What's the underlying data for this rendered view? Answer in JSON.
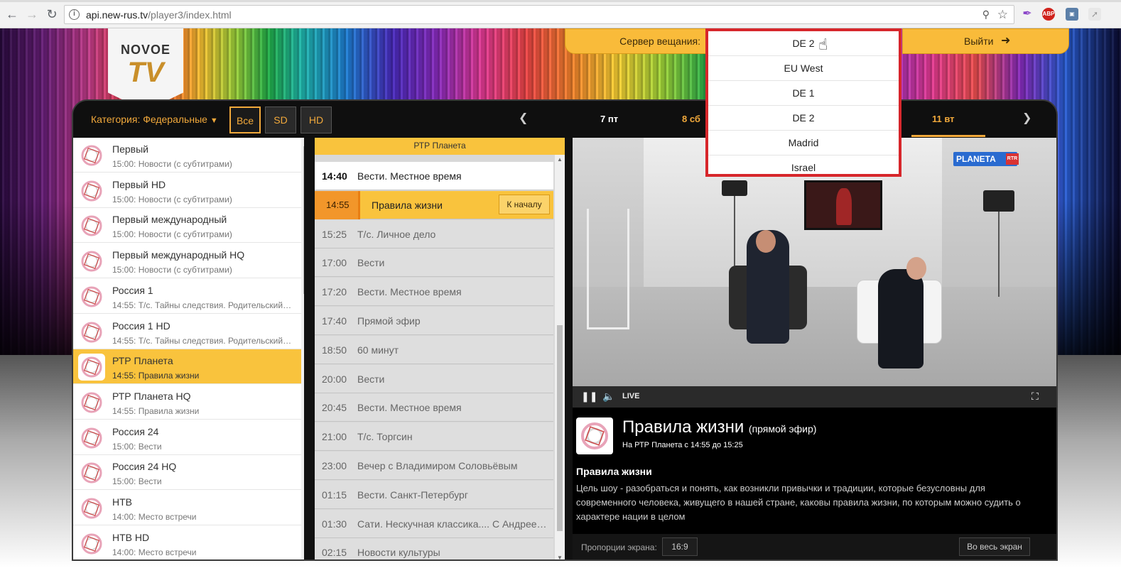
{
  "browser": {
    "url_host": "api.new-rus.tv",
    "url_path": "/player3/index.html"
  },
  "logo": {
    "top": "NOVOE",
    "bottom": "TV"
  },
  "header": {
    "server_label": "Сервер вещания:",
    "exit_label": "Выйти"
  },
  "server_dropdown": {
    "items": [
      "DE 2",
      "EU West",
      "DE 1",
      "DE 2",
      "Madrid",
      "Israel"
    ]
  },
  "topbar": {
    "category": "Категория: Федеральные",
    "filters": [
      "Все",
      "SD",
      "HD"
    ],
    "days": [
      "7 пт",
      "8 сб",
      "11 вт"
    ]
  },
  "channels": [
    {
      "name": "Первый",
      "show": "15:00: Новости (с субтитрами)"
    },
    {
      "name": "Первый HD",
      "show": "15:00: Новости (с субтитрами)"
    },
    {
      "name": "Первый международный",
      "show": "15:00: Новости (с субтитрами)"
    },
    {
      "name": "Первый международный HQ",
      "show": "15:00: Новости (с субтитрами)"
    },
    {
      "name": "Россия 1",
      "show": "14:55: Т/с. Тайны следствия. Родительский д..."
    },
    {
      "name": "Россия 1 HD",
      "show": "14:55: Т/с. Тайны следствия. Родительский д..."
    },
    {
      "name": "РТР Планета",
      "show": "14:55: Правила жизни"
    },
    {
      "name": "РТР Планета HQ",
      "show": "14:55: Правила жизни"
    },
    {
      "name": "Россия 24",
      "show": "15:00: Вести"
    },
    {
      "name": "Россия 24 HQ",
      "show": "15:00: Вести"
    },
    {
      "name": "НТВ",
      "show": "14:00: Место встречи"
    },
    {
      "name": "НТВ HD",
      "show": "14:00: Место встречи"
    }
  ],
  "schedule": {
    "channel": "РТР Планета",
    "to_start": "К началу",
    "rows": [
      {
        "time": "14:40",
        "title": "Вести. Местное время"
      },
      {
        "time": "14:55",
        "title": "Правила жизни"
      },
      {
        "time": "15:25",
        "title": "Т/с. Личное дело"
      },
      {
        "time": "17:00",
        "title": "Вести"
      },
      {
        "time": "17:20",
        "title": "Вести. Местное время"
      },
      {
        "time": "17:40",
        "title": "Прямой эфир"
      },
      {
        "time": "18:50",
        "title": "60 минут"
      },
      {
        "time": "20:00",
        "title": "Вести"
      },
      {
        "time": "20:45",
        "title": "Вести. Местное время"
      },
      {
        "time": "21:00",
        "title": "Т/с. Торгсин"
      },
      {
        "time": "23:00",
        "title": "Вечер с Владимиром Соловьёвым"
      },
      {
        "time": "01:15",
        "title": "Вести. Санкт-Петербург"
      },
      {
        "time": "01:30",
        "title": "Сати. Нескучная классика.... С Андреем..."
      },
      {
        "time": "02:15",
        "title": "Новости культуры"
      }
    ]
  },
  "video": {
    "watermark": "PLANETA",
    "watermark_badge": "RTR",
    "live_label": "LIVE"
  },
  "info": {
    "title": "Правила жизни",
    "title_suffix": "(прямой эфир)",
    "meta": "На РТР Планета  с 14:55  до 15:25",
    "name": "Правила жизни",
    "description": "Цель шоу - разобраться и понять, как возникли привычки и традиции, которые безусловны для современного человека, живущего в нашей стране, каковы правила жизни, по которым можно судить о характере нации в целом",
    "aspect_label": "Пропорции экрана:",
    "aspect_value": "16:9",
    "fullscreen_label": "Во весь экран"
  }
}
